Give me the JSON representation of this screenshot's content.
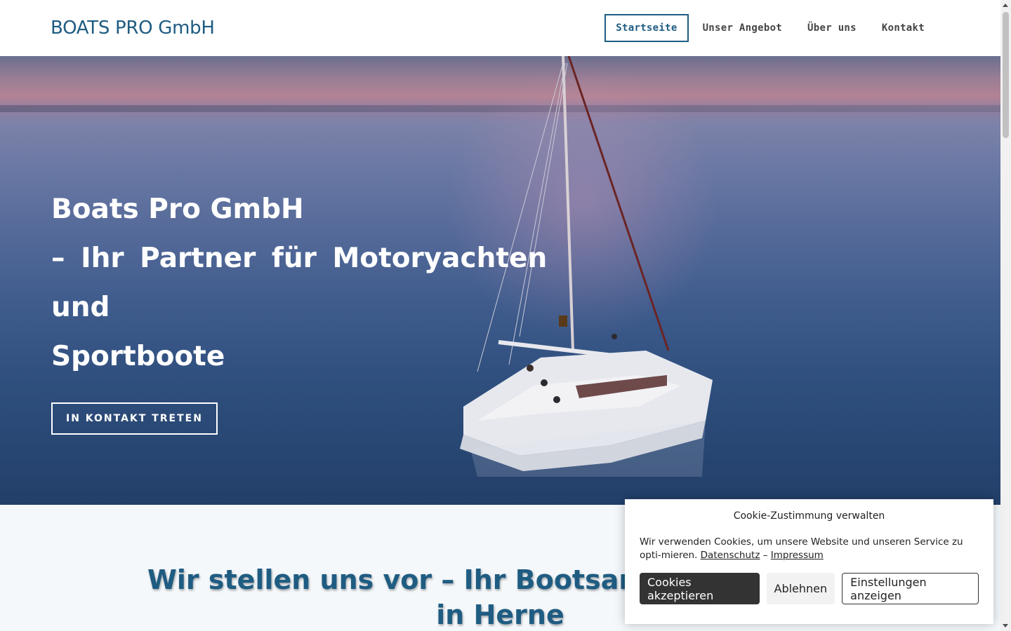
{
  "header": {
    "logo": "BOATS PRO GmbH",
    "nav": [
      {
        "label": "Startseite",
        "active": true
      },
      {
        "label": "Unser Angebot",
        "active": false
      },
      {
        "label": "Über uns",
        "active": false
      },
      {
        "label": "Kontakt",
        "active": false
      }
    ]
  },
  "hero": {
    "title_line1": "Boats Pro GmbH",
    "title_line2": "– Ihr Partner für Motoryachten und",
    "title_line3": "Sportboote",
    "cta": "IN KONTAKT TRETEN",
    "image_description_icon": "sailboat-photo"
  },
  "intro": {
    "heading": "Wir stellen uns vor – Ihr Bootsanbieter mit Sitz in Herne"
  },
  "cookie": {
    "title": "Cookie-Zustimmung verwalten",
    "text": "Wir verwenden Cookies, um unsere Website und unseren Service zu opti-mieren.",
    "link_privacy": "Datenschutz",
    "separator": "–",
    "link_imprint": "Impressum",
    "accept": "Cookies akzeptieren",
    "deny": "Ablehnen",
    "settings": "Einstellungen anzeigen"
  },
  "colors": {
    "brand": "#1f5c82",
    "cookie_accept_bg": "#333333"
  }
}
